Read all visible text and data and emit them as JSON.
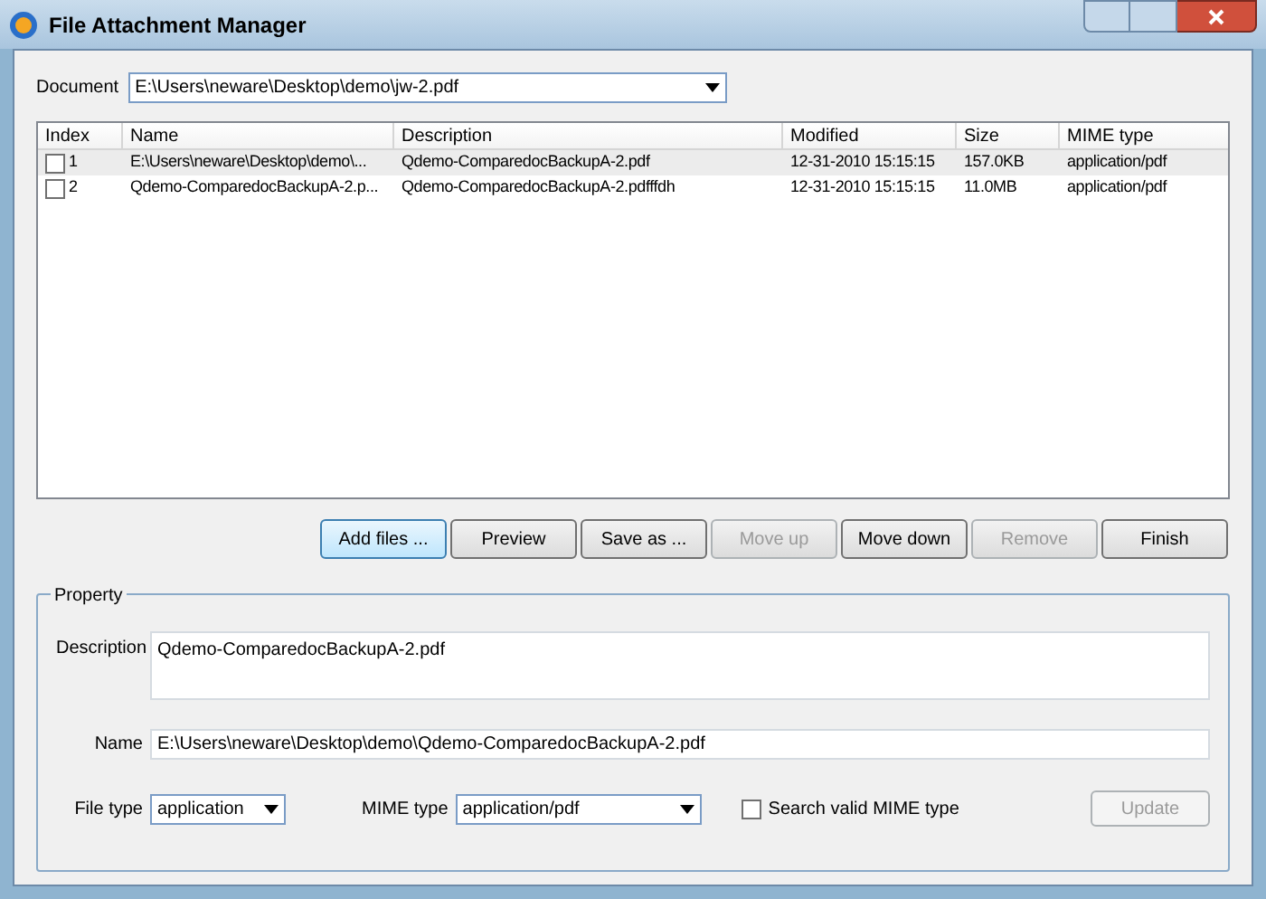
{
  "window": {
    "title": "File Attachment Manager"
  },
  "document": {
    "label": "Document",
    "value": "E:\\Users\\neware\\Desktop\\demo\\jw-2.pdf"
  },
  "table": {
    "columns": [
      "Index",
      "Name",
      "Description",
      "Modified",
      "Size",
      "MIME type"
    ],
    "rows": [
      {
        "checked": false,
        "selected": true,
        "cells": [
          "1",
          "E:\\Users\\neware\\Desktop\\demo\\...",
          "Qdemo-ComparedocBackupA-2.pdf",
          "12-31-2010  15:15:15",
          "157.0KB",
          "application/pdf"
        ]
      },
      {
        "checked": false,
        "selected": false,
        "cells": [
          "2",
          "Qdemo-ComparedocBackupA-2.p...",
          "Qdemo-ComparedocBackupA-2.pdfffdh",
          "12-31-2010  15:15:15",
          "11.0MB",
          "application/pdf"
        ]
      }
    ]
  },
  "buttons": [
    {
      "label": "Add files ...",
      "disabled": false,
      "focused": true
    },
    {
      "label": "Preview",
      "disabled": false,
      "focused": false
    },
    {
      "label": "Save as ...",
      "disabled": false,
      "focused": false
    },
    {
      "label": "Move up",
      "disabled": true,
      "focused": false
    },
    {
      "label": "Move down",
      "disabled": false,
      "focused": false
    },
    {
      "label": "Remove",
      "disabled": true,
      "focused": false
    },
    {
      "label": "Finish",
      "disabled": false,
      "focused": false
    }
  ],
  "property": {
    "title": "Property",
    "description": {
      "label": "Description",
      "value": "Qdemo-ComparedocBackupA-2.pdf"
    },
    "name": {
      "label": "Name",
      "value": "E:\\Users\\neware\\Desktop\\demo\\Qdemo-ComparedocBackupA-2.pdf"
    },
    "file_type": {
      "label": "File type",
      "value": "application"
    },
    "mime_type": {
      "label": "MIME type",
      "value": "application/pdf"
    },
    "search_valid": {
      "label": "Search valid MIME type",
      "checked": false
    },
    "update": {
      "label": "Update",
      "disabled": true
    }
  }
}
